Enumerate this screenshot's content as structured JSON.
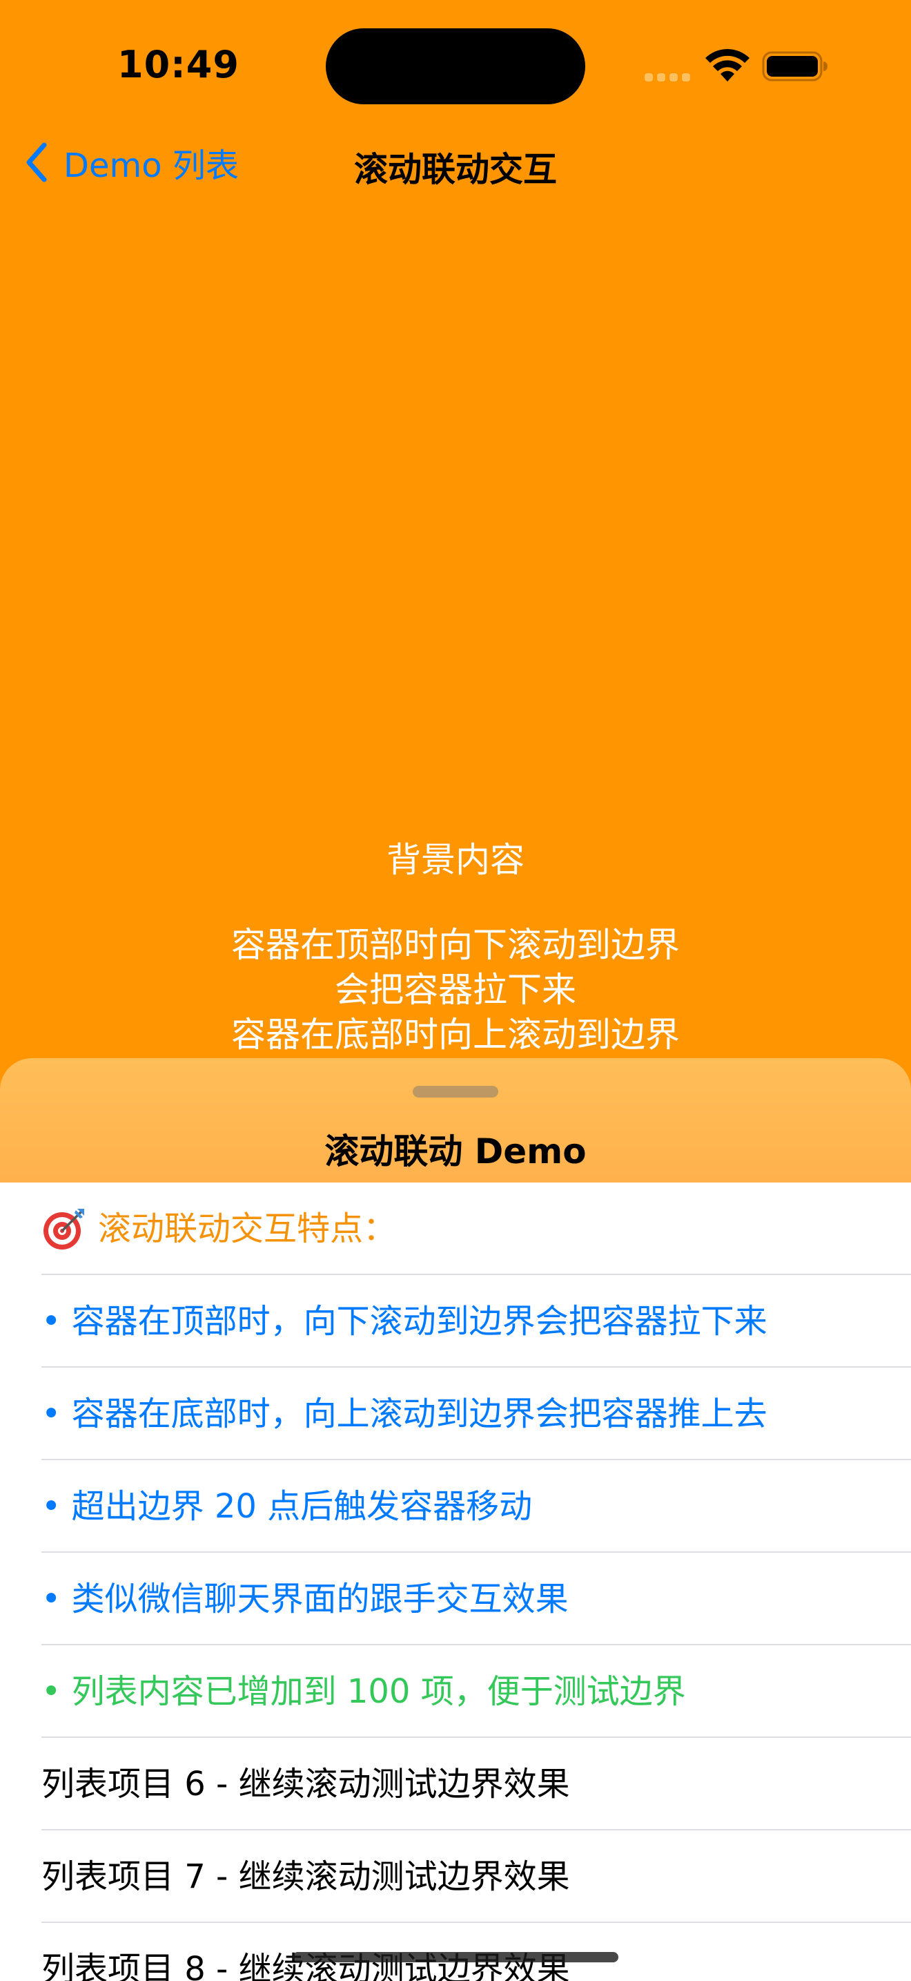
{
  "status_bar": {
    "time": "10:49"
  },
  "nav": {
    "back_label": "Demo 列表",
    "title": "滚动联动交互"
  },
  "background": {
    "heading": "背景内容",
    "lines": [
      "容器在顶部时向下滚动到边界",
      "会把容器拉下来",
      "容器在底部时向上滚动到边界"
    ]
  },
  "sheet": {
    "title": "滚动联动 Demo",
    "header_row": {
      "icon": "target-icon",
      "label": "滚动联动交互特点："
    },
    "feature_rows": [
      {
        "label": "• 容器在顶部时，向下滚动到边界会把容器拉下来",
        "color": "#007AFF"
      },
      {
        "label": "• 容器在底部时，向上滚动到边界会把容器推上去",
        "color": "#007AFF"
      },
      {
        "label": "• 超出边界 20 点后触发容器移动",
        "color": "#007AFF"
      },
      {
        "label": "• 类似微信聊天界面的跟手交互效果",
        "color": "#007AFF"
      },
      {
        "label": "• 列表内容已增加到 100 项，便于测试边界",
        "color": "#34C759"
      }
    ],
    "items": [
      "列表项目 6 - 继续滚动测试边界效果",
      "列表项目 7 - 继续滚动测试边界效果",
      "列表项目 8 - 继续滚动测试边界效果"
    ]
  },
  "colors": {
    "background": "#FF9500",
    "accent": "#007AFF",
    "header_text": "#F4920A",
    "success": "#34C759"
  }
}
